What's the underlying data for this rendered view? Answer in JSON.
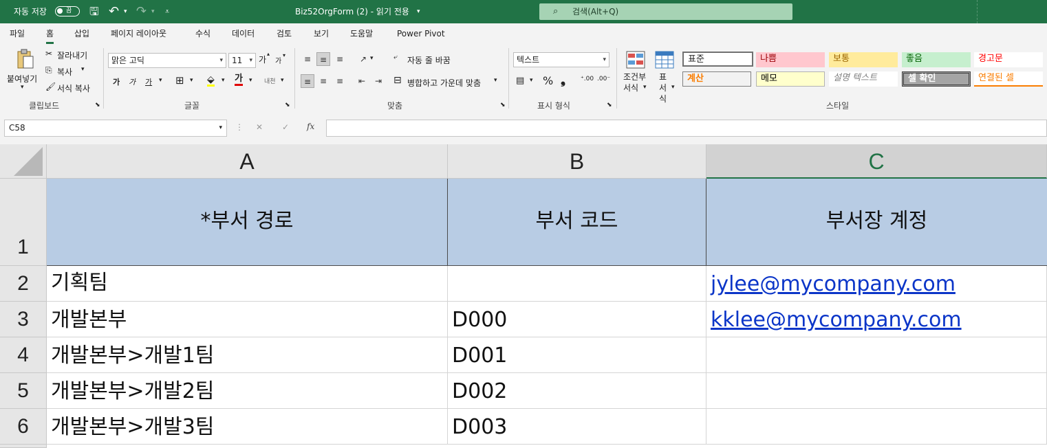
{
  "titlebar": {
    "autosave_label": "자동 저장",
    "autosave_state": "끔",
    "file_title": "Biz52OrgForm (2)  -  읽기 전용",
    "search_placeholder": "검색(Alt+Q)"
  },
  "menu": {
    "tabs": [
      "파일",
      "홈",
      "삽입",
      "페이지 레이아웃",
      "수식",
      "데이터",
      "검토",
      "보기",
      "도움말",
      "Power Pivot"
    ],
    "active_tab": "홈"
  },
  "ribbon": {
    "clipboard": {
      "paste": "붙여넣기",
      "cut": "잘라내기",
      "copy": "복사",
      "format_painter": "서식 복사",
      "label": "클립보드"
    },
    "font": {
      "font_name": "맑은 고딕",
      "font_size": "11",
      "bold": "가",
      "italic": "가",
      "underline": "가",
      "grow": "가",
      "shrink": "가",
      "label": "글꼴"
    },
    "alignment": {
      "wrap_text": "자동 줄 바꿈",
      "merge_center": "병합하고 가운데 맞춤",
      "label": "맞춤"
    },
    "number": {
      "format": "텍스트",
      "label": "표시 형식"
    },
    "styles": {
      "conditional": "조건부 서식",
      "table": "표 서식",
      "label": "스타일",
      "cells": [
        {
          "name": "표준",
          "bg": "#ffffff",
          "fg": "#000000"
        },
        {
          "name": "나쁨",
          "bg": "#ffc7ce",
          "fg": "#9c0006"
        },
        {
          "name": "보통",
          "bg": "#ffeb9c",
          "fg": "#9c6500"
        },
        {
          "name": "좋음",
          "bg": "#c6efce",
          "fg": "#006100"
        },
        {
          "name": "경고문",
          "bg": "#ffffff",
          "fg": "#ff0000"
        },
        {
          "name": "계산",
          "bg": "#f2f2f2",
          "fg": "#fa7d00"
        },
        {
          "name": "메모",
          "bg": "#ffffcc",
          "fg": "#000000"
        },
        {
          "name": "설명 텍스트",
          "bg": "#ffffff",
          "fg": "#7f7f7f"
        },
        {
          "name": "셀 확인",
          "bg": "#a5a5a5",
          "fg": "#ffffff"
        },
        {
          "name": "연결된 셀",
          "bg": "#ffffff",
          "fg": "#fa7d00"
        }
      ]
    }
  },
  "formula_bar": {
    "name_box": "C58",
    "cancel": "✕",
    "enter": "✓",
    "fx": "fx",
    "content": ""
  },
  "sheet": {
    "columns": [
      "A",
      "B",
      "C"
    ],
    "selected_column": "C",
    "rows": [
      {
        "num": "1",
        "cells": [
          "*부서 경로",
          "부서 코드",
          "부서장 계정"
        ]
      },
      {
        "num": "2",
        "cells": [
          "기획팀",
          "",
          "jylee@mycompany.com"
        ]
      },
      {
        "num": "3",
        "cells": [
          "개발본부",
          "D000",
          "kklee@mycompany.com"
        ]
      },
      {
        "num": "4",
        "cells": [
          "개발본부>개발1팀",
          "D001",
          ""
        ]
      },
      {
        "num": "5",
        "cells": [
          "개발본부>개발2팀",
          "D002",
          ""
        ]
      },
      {
        "num": "6",
        "cells": [
          "개발본부>개발3팀",
          "D003",
          ""
        ]
      }
    ]
  },
  "colors": {
    "accent": "#217346",
    "header_fill": "#b8cce4",
    "link": "#0b35c8"
  }
}
